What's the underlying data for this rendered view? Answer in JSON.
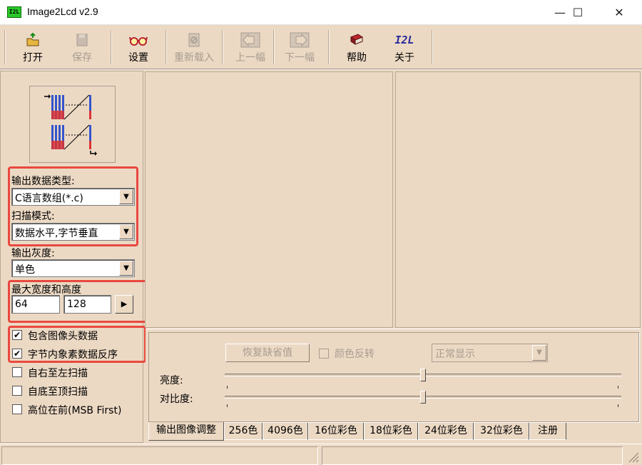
{
  "window": {
    "title": "Image2Lcd v2.9",
    "icon_text": "I2L",
    "controls": {
      "minimize": "—",
      "maximize": "☐",
      "close": "✕"
    }
  },
  "toolbar": {
    "open": "打开",
    "save": "保存",
    "settings": "设置",
    "reload": "重新载入",
    "prev": "上一幅",
    "next": "下一幅",
    "help": "帮助",
    "about": "关于",
    "about_icon_text": "I2L"
  },
  "left": {
    "output_type_label": "输出数据类型:",
    "output_type_value": "C语言数组(*.c)",
    "scan_mode_label": "扫描模式:",
    "scan_mode_value": "数据水平,字节垂直",
    "gray_label": "输出灰度:",
    "gray_value": "单色",
    "size_label": "最大宽度和高度",
    "width_value": "64",
    "height_value": "128",
    "size_arrow": "▶",
    "checkboxes": [
      {
        "label": "包含图像头数据",
        "checked": true
      },
      {
        "label": "字节内象素数据反序",
        "checked": true
      },
      {
        "label": "自右至左扫描",
        "checked": false
      },
      {
        "label": "自底至顶扫描",
        "checked": false
      },
      {
        "label": "高位在前(MSB First)",
        "checked": false
      }
    ]
  },
  "adjust": {
    "restore_button": "恢复缺省值",
    "invert_label": "颜色反转",
    "display_mode": "正常显示",
    "brightness_label": "亮度:",
    "contrast_label": "对比度:",
    "brightness_level": 0.5,
    "contrast_level": 0.5
  },
  "tabs": [
    "输出图像调整",
    "256色",
    "4096色",
    "16位彩色",
    "18位彩色",
    "24位彩色",
    "32位彩色",
    "注册"
  ],
  "colors": {
    "window_bg": "#ecd9c4",
    "highlight_frame": "#e8483f",
    "disabled_text": "#a89c8f"
  }
}
